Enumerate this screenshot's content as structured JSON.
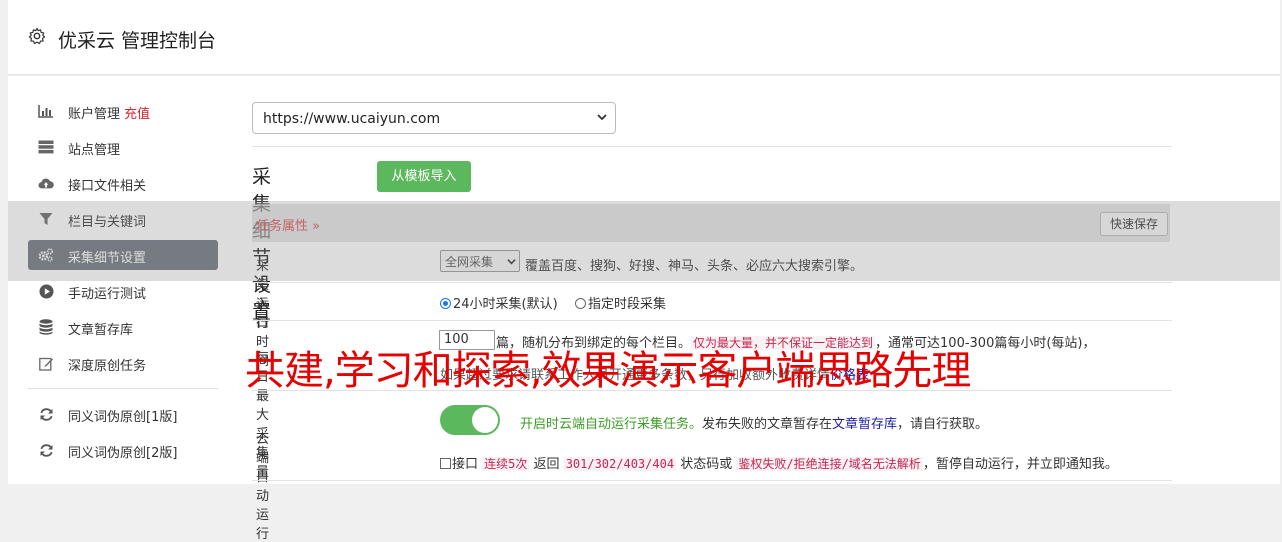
{
  "header": {
    "title": "优采云 管理控制台"
  },
  "sidebar": {
    "items": [
      {
        "label": "账户管理",
        "extra": "充值",
        "icon": "bar-chart-icon"
      },
      {
        "label": "站点管理",
        "icon": "server-icon"
      },
      {
        "label": "接口文件相关",
        "icon": "cloud-upload-icon"
      },
      {
        "label": "栏目与关键词",
        "icon": "filter-icon"
      },
      {
        "label": "采集细节设置",
        "icon": "cogs-icon",
        "active": true
      },
      {
        "label": "手动运行测试",
        "icon": "play-circle-icon"
      },
      {
        "label": "文章暂存库",
        "icon": "database-icon"
      },
      {
        "label": "深度原创任务",
        "icon": "edit-icon"
      },
      {
        "label": "同义词伪原创[1版]",
        "icon": "refresh-icon"
      },
      {
        "label": "同义词伪原创[2版]",
        "icon": "refresh-icon"
      }
    ]
  },
  "site_select": {
    "value": "https://www.ucaiyun.com"
  },
  "section": {
    "title": "采集细节设置",
    "import_button": "从模板导入"
  },
  "task": {
    "label": "任务属性 »",
    "save_button": "快速保存"
  },
  "rows": {
    "entry": {
      "label": "采集入口",
      "select_value": "全网采集",
      "desc": "覆盖百度、搜狗、好搜、神马、头条、必应六大搜索引擎。"
    },
    "run_time": {
      "label": "运行时间",
      "option1": "24小时采集(默认)",
      "option2": "指定时段采集"
    },
    "volume": {
      "label": "每日最大采集量",
      "value": "100",
      "text1": "篇，随机分布到绑定的每个栏目。",
      "highlight": "仅为最大量，并不保证一定能达到",
      "text2": "，通常可达100-300篇每小时(每站)，",
      "line2": "如果超过要求请联系工作人员开通更多条数，另行加收额外收费详情",
      "link": "价格表"
    },
    "cloud": {
      "label": "云端自动运行",
      "enabled_text": "开启时云端自动运行采集任务。",
      "desc1": "发布失败的文章暂存在",
      "link": "文章暂存库",
      "desc2": "，请自行获取。",
      "cb_label": "接口",
      "hl1": "连续5次",
      "t1": "返回",
      "hl2": "301/302/403/404",
      "t2": "状态码或",
      "hl3": "鉴权失败/拒绝连接/域名无法解析",
      "t3": "，暂停自动运行，并立即通知我。"
    }
  },
  "watermark": "共建,学习和探索,效果演示客户端思路先理"
}
